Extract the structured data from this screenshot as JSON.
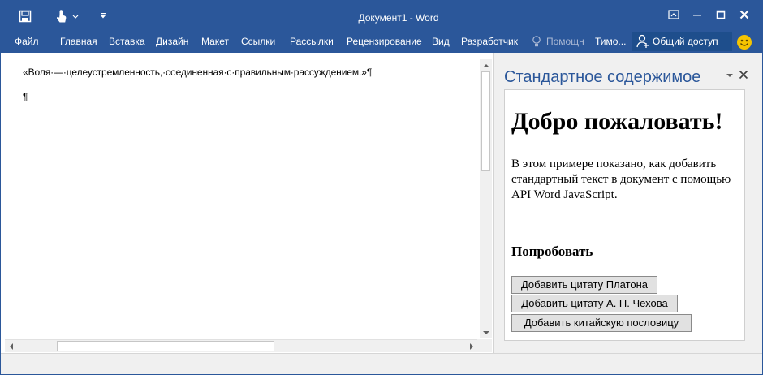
{
  "window": {
    "title": "Документ1 - Word",
    "accent_color": "#2b579a"
  },
  "quick_access": {
    "save_icon": "save-icon",
    "touch_icon": "touch-mode-icon",
    "customize_icon": "customize-qat-icon"
  },
  "ribbon": {
    "tabs": [
      {
        "label": "Файл"
      },
      {
        "label": "Главная"
      },
      {
        "label": "Вставка"
      },
      {
        "label": "Дизайн"
      },
      {
        "label": "Макет"
      },
      {
        "label": "Ссылки"
      },
      {
        "label": "Рассылки"
      },
      {
        "label": "Рецензирование"
      },
      {
        "label": "Вид"
      },
      {
        "label": "Разработчик"
      }
    ],
    "help_label": "Помощн",
    "user_label": "Тимо...",
    "share_label": "Общий доступ"
  },
  "document": {
    "paragraphs": [
      "«Воля·—·целеустремленность,·соединенная·с·правильным·рассуждением.»¶",
      "¶"
    ]
  },
  "task_pane": {
    "title": "Стандартное содержимое",
    "heading": "Добро пожаловать!",
    "description": "В этом примере показано, как добавить стандартный текст в документ с помощью API Word JavaScript.",
    "try_heading": "Попробовать",
    "buttons": [
      {
        "label": "Добавить цитату Платона"
      },
      {
        "label": "Добавить цитату А. П. Чехова"
      },
      {
        "label": "Добавить китайскую пословицу"
      }
    ]
  }
}
